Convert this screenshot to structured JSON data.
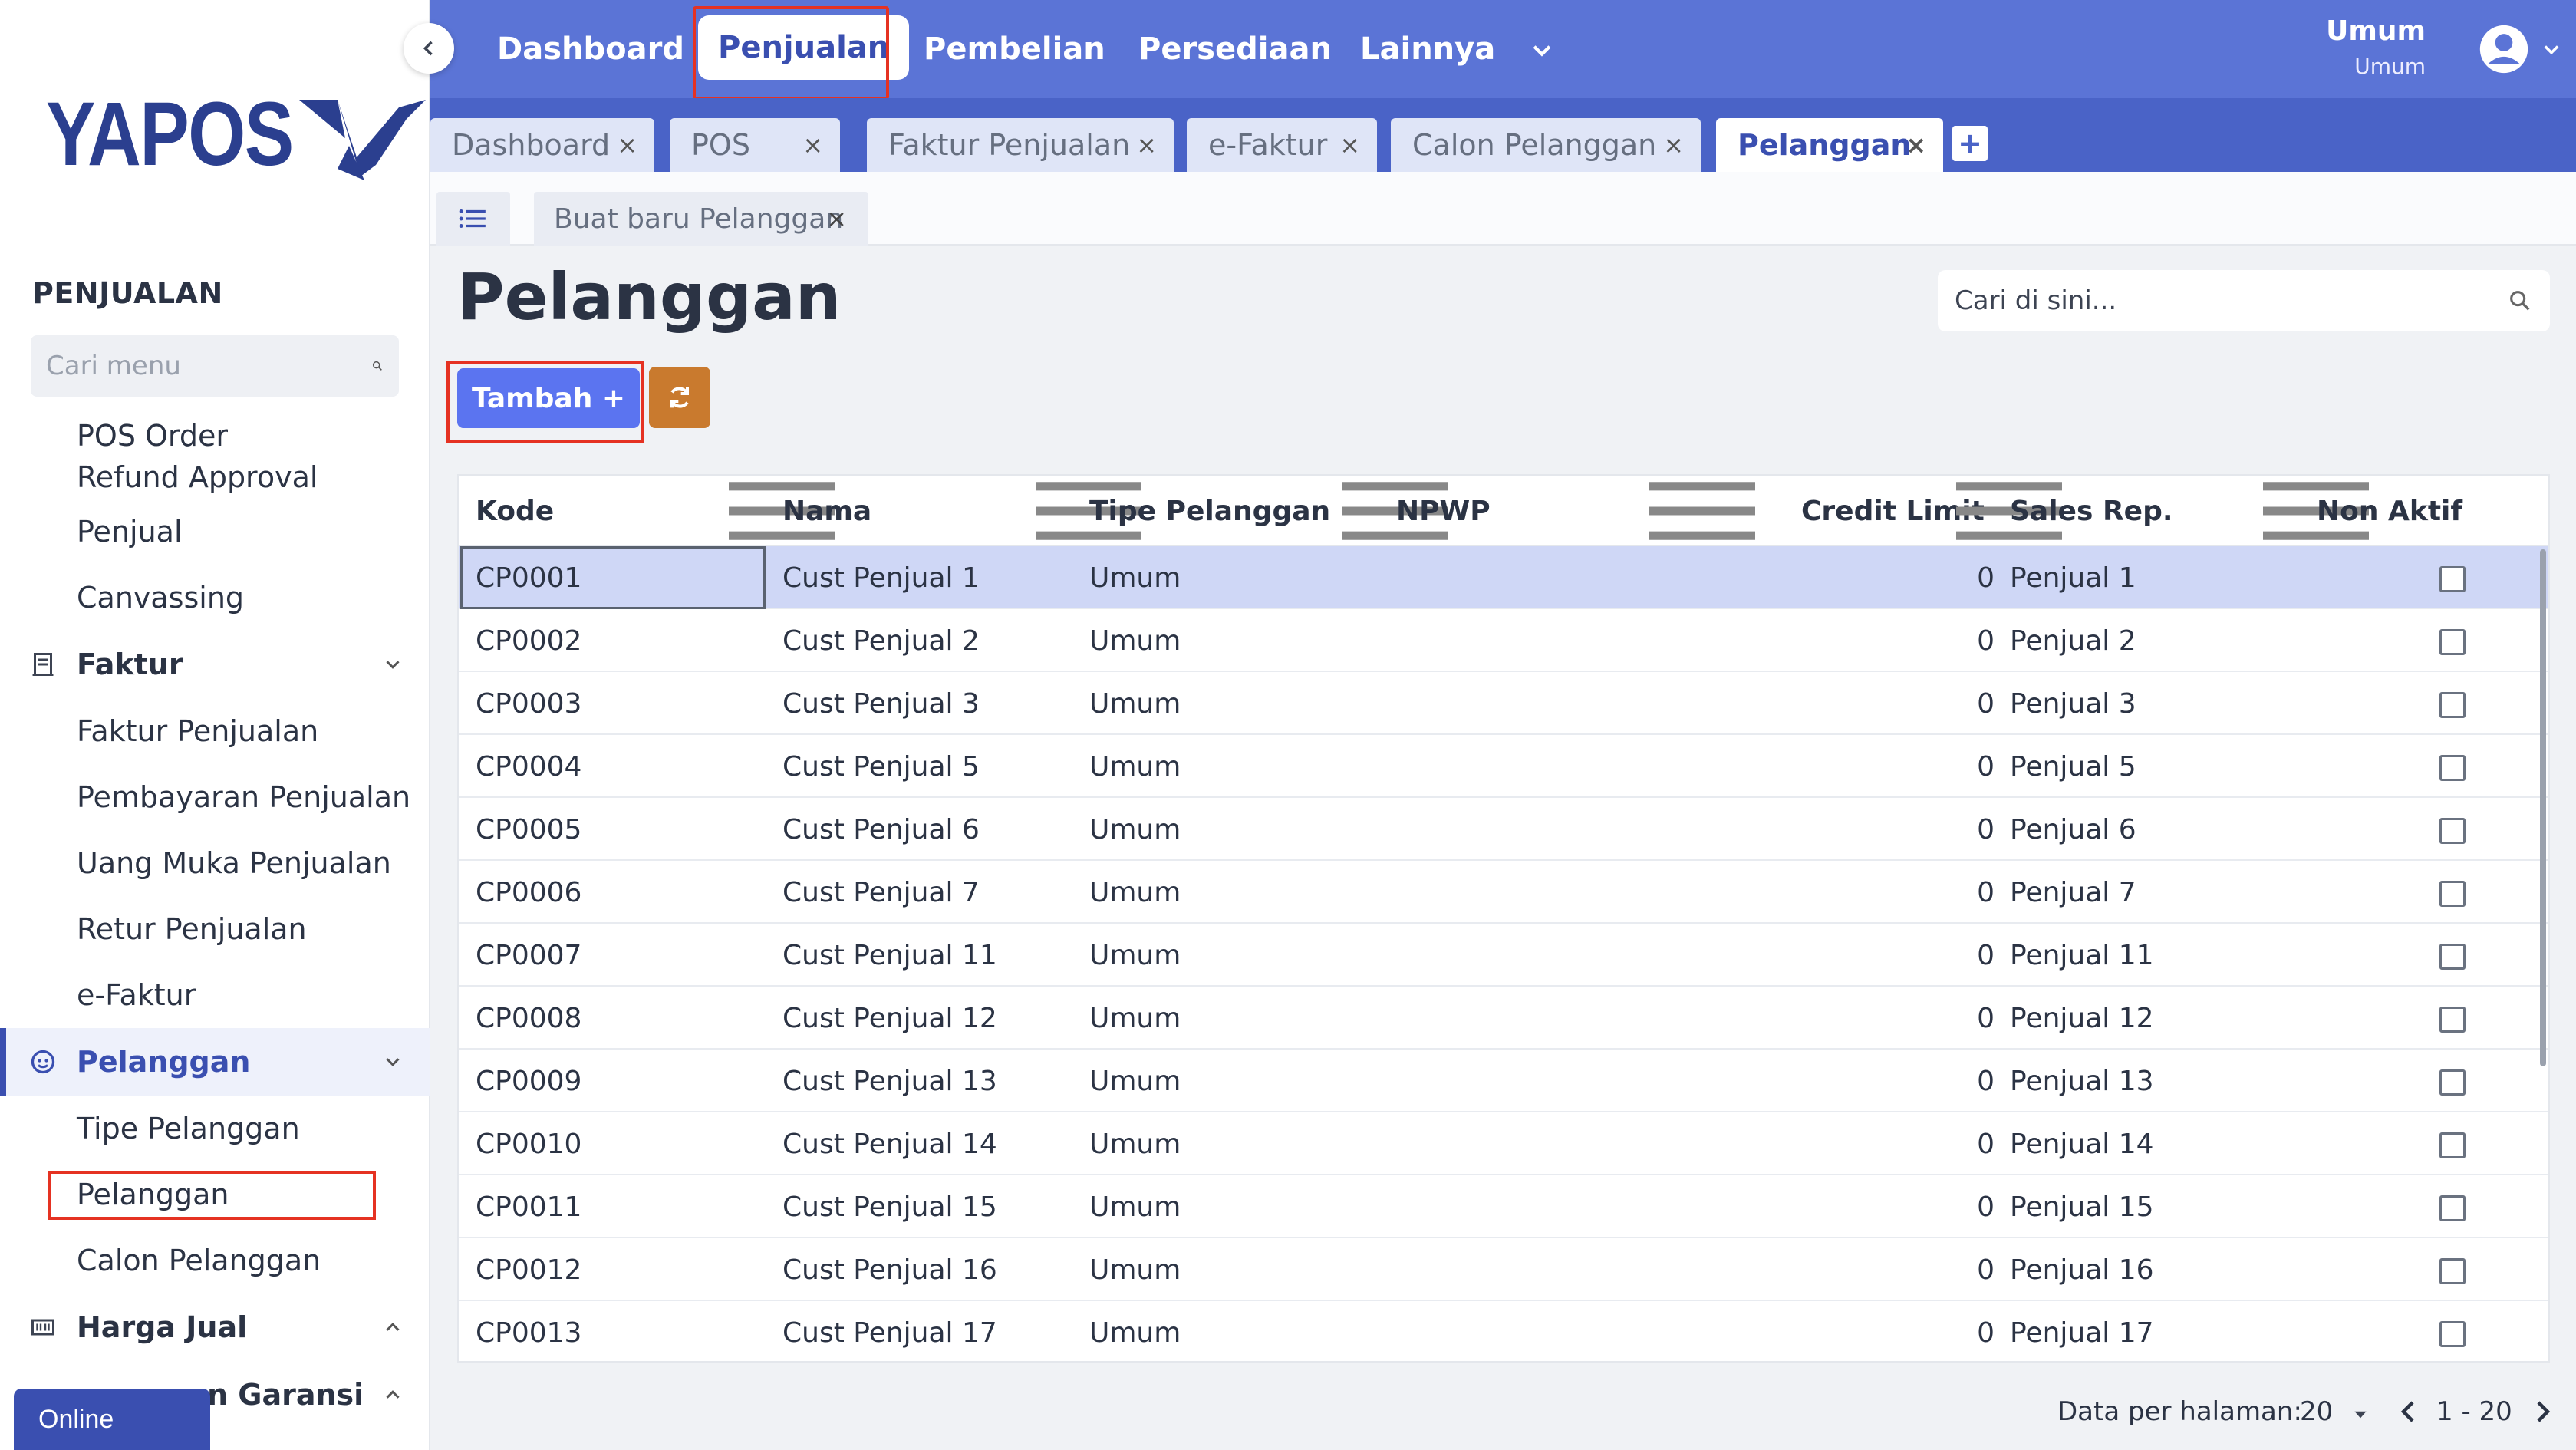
{
  "sidebar": {
    "logo": "YAPOS",
    "section_title": "PENJUALAN",
    "search_placeholder": "Cari menu",
    "items": [
      {
        "label": "POS Order Refund Approval"
      },
      {
        "label": "Penjual"
      },
      {
        "label": "Canvassing"
      },
      {
        "label": "Faktur"
      },
      {
        "label": "Faktur Penjualan"
      },
      {
        "label": "Pembayaran Penjualan"
      },
      {
        "label": "Uang Muka Penjualan"
      },
      {
        "label": "Retur Penjualan"
      },
      {
        "label": "e-Faktur"
      },
      {
        "label": "Pelanggan"
      },
      {
        "label": "Tipe Pelanggan"
      },
      {
        "label": "Pelanggan"
      },
      {
        "label": "Calon Pelanggan"
      },
      {
        "label": "Harga Jual"
      },
      {
        "label": "n Garansi"
      }
    ],
    "status": "Online"
  },
  "topbar": {
    "nav": [
      "Dashboard",
      "Penjualan",
      "Pembelian",
      "Persediaan",
      "Lainnya"
    ],
    "user_name": "Umum",
    "user_role": "Umum"
  },
  "tabs": [
    "Dashboard",
    "POS",
    "Faktur Penjualan",
    "e-Faktur",
    "Calon Pelanggan",
    "Pelanggan"
  ],
  "subtab": "Buat baru Pelanggan",
  "page": {
    "title": "Pelanggan",
    "search_placeholder": "Cari di sini...",
    "add_label": "Tambah +"
  },
  "table": {
    "columns": [
      "Kode",
      "Nama",
      "Tipe Pelanggan",
      "NPWP",
      "Credit Limit",
      "Sales Rep.",
      "Non Aktif"
    ],
    "rows": [
      [
        "CP0001",
        "Cust Penjual 1",
        "Umum",
        "",
        "0",
        "Penjual 1"
      ],
      [
        "CP0002",
        "Cust Penjual 2",
        "Umum",
        "",
        "0",
        "Penjual 2"
      ],
      [
        "CP0003",
        "Cust Penjual 3",
        "Umum",
        "",
        "0",
        "Penjual 3"
      ],
      [
        "CP0004",
        "Cust Penjual 5",
        "Umum",
        "",
        "0",
        "Penjual 5"
      ],
      [
        "CP0005",
        "Cust Penjual 6",
        "Umum",
        "",
        "0",
        "Penjual 6"
      ],
      [
        "CP0006",
        "Cust Penjual 7",
        "Umum",
        "",
        "0",
        "Penjual 7"
      ],
      [
        "CP0007",
        "Cust Penjual 11",
        "Umum",
        "",
        "0",
        "Penjual 11"
      ],
      [
        "CP0008",
        "Cust Penjual 12",
        "Umum",
        "",
        "0",
        "Penjual 12"
      ],
      [
        "CP0009",
        "Cust Penjual 13",
        "Umum",
        "",
        "0",
        "Penjual 13"
      ],
      [
        "CP0010",
        "Cust Penjual 14",
        "Umum",
        "",
        "0",
        "Penjual 14"
      ],
      [
        "CP0011",
        "Cust Penjual 15",
        "Umum",
        "",
        "0",
        "Penjual 15"
      ],
      [
        "CP0012",
        "Cust Penjual 16",
        "Umum",
        "",
        "0",
        "Penjual 16"
      ],
      [
        "CP0013",
        "Cust Penjual 17",
        "Umum",
        "",
        "0",
        "Penjual 17"
      ]
    ]
  },
  "pager": {
    "label": "Data per halaman:",
    "size": "20",
    "range": "1 - 20"
  },
  "colors": {
    "primary": "#5b74d6",
    "tabstrip": "#4a63c7",
    "add_button": "#5b74f0",
    "refresh_button": "#c97a2e",
    "highlight": "#e53222",
    "selected_row": "#cfd7f6"
  }
}
